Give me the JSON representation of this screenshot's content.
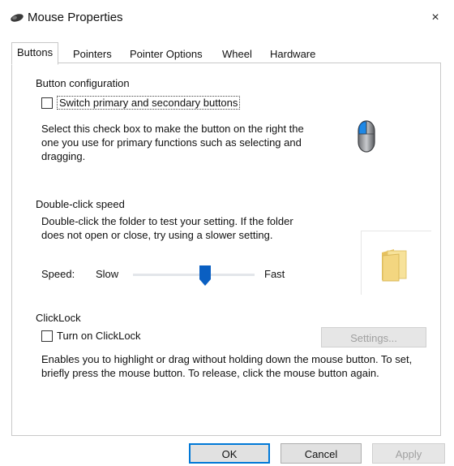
{
  "window": {
    "title": "Mouse Properties",
    "close_glyph": "×",
    "icon": "mouse-icon"
  },
  "tabs": [
    {
      "label": "Buttons",
      "active": true
    },
    {
      "label": "Pointers",
      "active": false
    },
    {
      "label": "Pointer Options",
      "active": false
    },
    {
      "label": "Wheel",
      "active": false
    },
    {
      "label": "Hardware",
      "active": false
    }
  ],
  "button_configuration": {
    "title": "Button configuration",
    "checkbox_label": "Switch primary and secondary buttons",
    "checked": false,
    "description": "Select this check box to make the button on the right the one you use for primary functions such as selecting and dragging.",
    "image_icon": "mouse-left-button-icon"
  },
  "double_click": {
    "title": "Double-click speed",
    "description": "Double-click the folder to test your setting. If the folder does not open or close, try using a slower setting.",
    "speed_label": "Speed:",
    "slow_label": "Slow",
    "fast_label": "Fast",
    "speed_value_fraction": 0.57,
    "test_folder_icon": "folder-icon"
  },
  "clicklock": {
    "title": "ClickLock",
    "checkbox_label": "Turn on ClickLock",
    "checked": false,
    "settings_button": "Settings...",
    "settings_enabled": false,
    "description": "Enables you to highlight or drag without holding down the mouse button. To set, briefly press the mouse button. To release, click the mouse button again."
  },
  "footer": {
    "ok": "OK",
    "cancel": "Cancel",
    "apply": "Apply",
    "apply_enabled": false
  },
  "colors": {
    "accent": "#0078d7",
    "slider_thumb": "#0a5fc2",
    "folder": "#f3d680"
  }
}
